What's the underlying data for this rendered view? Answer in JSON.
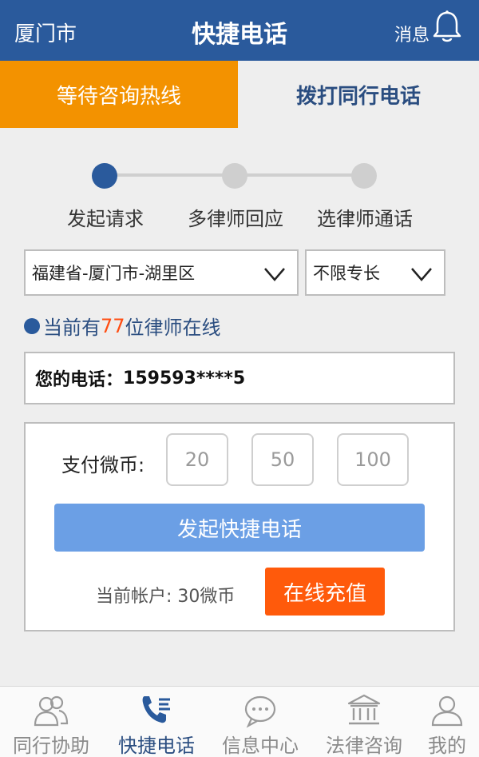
{
  "header": {
    "city": "厦门市",
    "title": "快捷电话",
    "message_label": "消息"
  },
  "tabs": [
    {
      "label": "等待咨询热线",
      "active": true
    },
    {
      "label": "拨打同行电话",
      "active": false
    }
  ],
  "steps": [
    {
      "label": "发起请求",
      "active": true
    },
    {
      "label": "多律师回应",
      "active": false
    },
    {
      "label": "选律师通话",
      "active": false
    }
  ],
  "filters": {
    "region": "福建省-厦门市-湖里区",
    "specialty": "不限专长"
  },
  "online": {
    "prefix": "当前有",
    "count": "77",
    "suffix": "位律师在线"
  },
  "phone": {
    "label": "您的电话：",
    "number": "159593****5"
  },
  "payment": {
    "label": "支付微币:",
    "options": [
      "20",
      "50",
      "100"
    ],
    "start_button": "发起快捷电话",
    "account": "当前帐户: 30微币",
    "recharge_button": "在线充值"
  },
  "bottom_nav": [
    {
      "label": "同行协助",
      "icon": "users-icon",
      "active": false
    },
    {
      "label": "快捷电话",
      "icon": "phone-icon",
      "active": true
    },
    {
      "label": "信息中心",
      "icon": "chat-icon",
      "active": false
    },
    {
      "label": "法律咨询",
      "icon": "court-icon",
      "active": false
    },
    {
      "label": "我的",
      "icon": "user-icon",
      "active": false
    }
  ],
  "colors": {
    "header_bg": "#2a5a9c",
    "tab_active_bg": "#f39200",
    "button_blue": "#6b9fe5",
    "recharge_orange": "#ff5a0b",
    "online_count": "#ff4d12"
  }
}
